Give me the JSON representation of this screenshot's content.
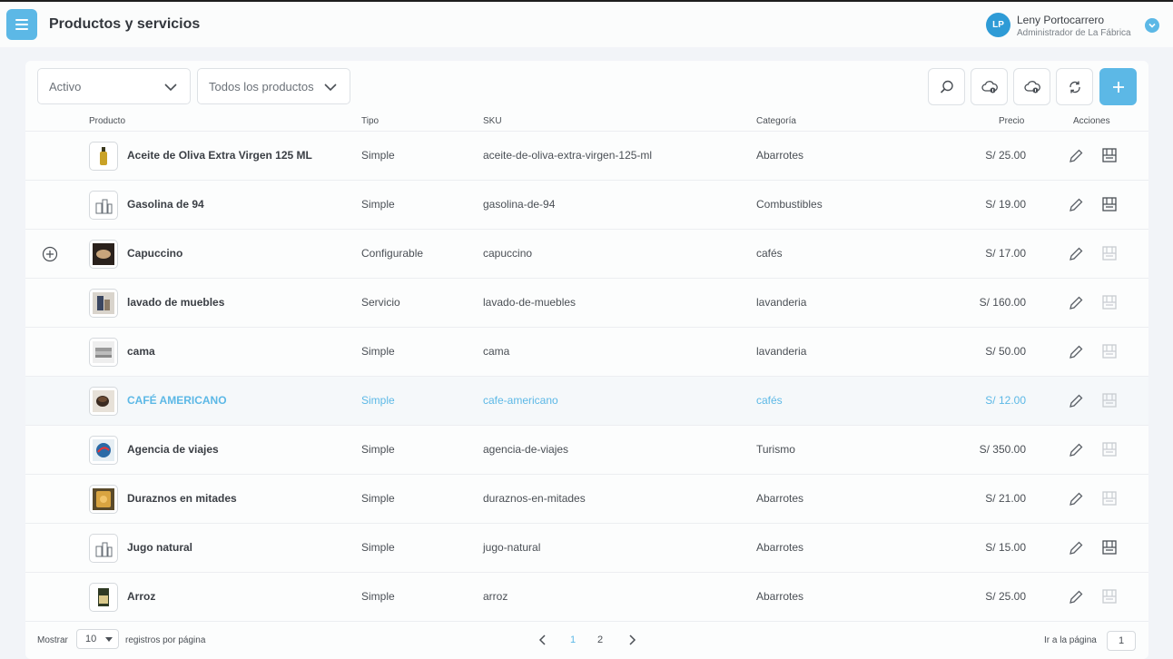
{
  "header": {
    "title": "Productos y servicios",
    "user_initials": "LP",
    "user_name": "Leny Portocarrero",
    "user_role": "Administrador de La Fábrica"
  },
  "filters": {
    "status": "Activo",
    "products": "Todos los productos"
  },
  "table": {
    "columns": {
      "product": "Producto",
      "type": "Tipo",
      "sku": "SKU",
      "category": "Categoría",
      "price": "Precio",
      "actions": "Acciones"
    },
    "rows": [
      {
        "name": "Aceite de Oliva Extra Virgen 125 ML",
        "type": "Simple",
        "sku": "aceite-de-oliva-extra-virgen-125-ml",
        "category": "Abarrotes",
        "price": "S/ 25.00"
      },
      {
        "name": "Gasolina de 94",
        "type": "Simple",
        "sku": "gasolina-de-94",
        "category": "Combustibles",
        "price": "S/ 19.00"
      },
      {
        "name": "Capuccino",
        "type": "Configurable",
        "sku": "capuccino",
        "category": "cafés",
        "price": "S/ 17.00"
      },
      {
        "name": "lavado de muebles",
        "type": "Servicio",
        "sku": "lavado-de-muebles",
        "category": "lavanderia",
        "price": "S/ 160.00"
      },
      {
        "name": "cama",
        "type": "Simple",
        "sku": "cama",
        "category": "lavanderia",
        "price": "S/ 50.00"
      },
      {
        "name": "CAFÉ AMERICANO",
        "type": "Simple",
        "sku": "cafe-americano",
        "category": "cafés",
        "price": "S/ 12.00"
      },
      {
        "name": "Agencia de viajes",
        "type": "Simple",
        "sku": "agencia-de-viajes",
        "category": "Turismo",
        "price": "S/ 350.00"
      },
      {
        "name": "Duraznos en mitades",
        "type": "Simple",
        "sku": "duraznos-en-mitades",
        "category": "Abarrotes",
        "price": "S/ 21.00"
      },
      {
        "name": "Jugo natural",
        "type": "Simple",
        "sku": "jugo-natural",
        "category": "Abarrotes",
        "price": "S/ 15.00"
      },
      {
        "name": "Arroz",
        "type": "Simple",
        "sku": "arroz",
        "category": "Abarrotes",
        "price": "S/ 25.00"
      }
    ]
  },
  "footer": {
    "show_label": "Mostrar",
    "per_page_value": "10",
    "per_page_suffix": "registros por página",
    "pages": [
      "1",
      "2"
    ],
    "current_page": "1",
    "goto_label": "Ir a la página",
    "goto_value": "1"
  },
  "colors": {
    "accent": "#5cb8e6",
    "avatar": "#2e9bd6"
  }
}
